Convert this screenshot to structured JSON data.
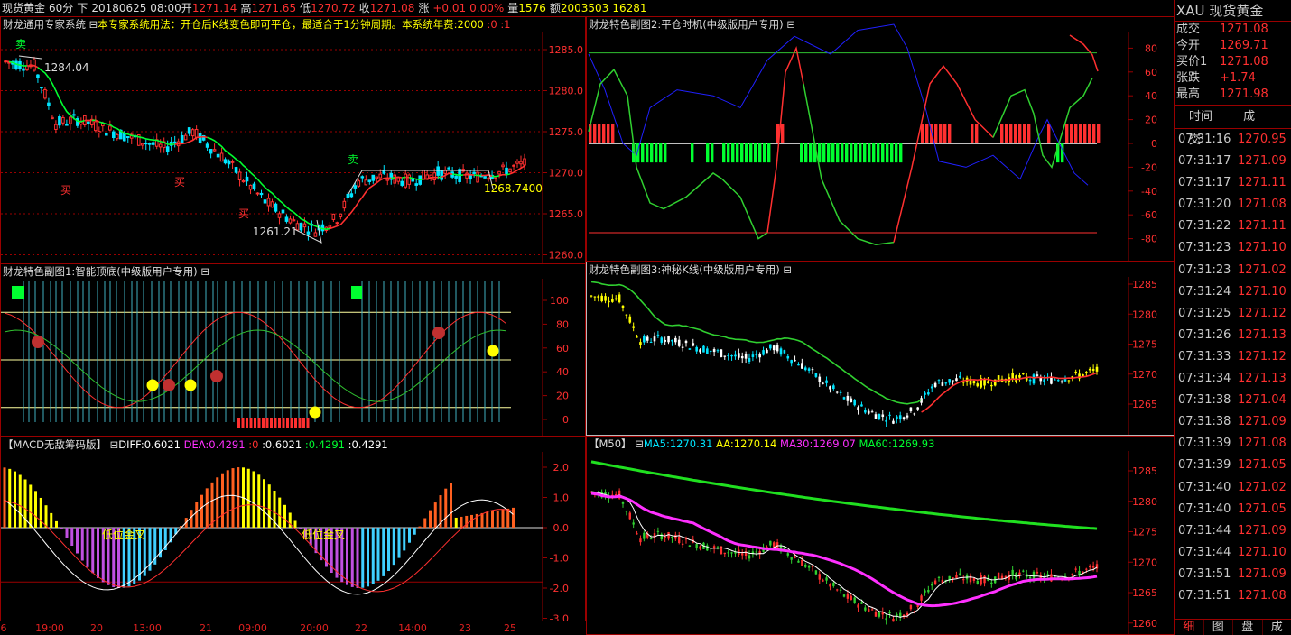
{
  "topbar": {
    "name": "现货黄金",
    "period": "60分",
    "direction": "下",
    "date": "20180625 08:00",
    "open_label": "开",
    "open": "1271.14",
    "high_label": "高",
    "high": "1271.65",
    "low_label": "低",
    "low": "1270.72",
    "close_label": "收",
    "close": "1271.08",
    "change_label": "涨",
    "change": "+0.01",
    "change_pct": "0.00%",
    "volume_label": "量",
    "volume": "1576",
    "amount_label": "额",
    "amount": "2003503",
    "hold": "16281"
  },
  "panels": {
    "main": {
      "title_system": "财龙通用专家系统",
      "title_icon": "⊟",
      "title_usage": "本专家系统用法：开仓后K线变色即可平仓，最适合于1分钟周期。本系统年费:2000",
      "title_v1": ":0",
      "title_v2": ":1",
      "yticks": [
        "1285.0",
        "1280.0",
        "1275.0",
        "1270.0",
        "1265.0",
        "1260.0"
      ],
      "label_high": "1284.04",
      "label_low": "1261.21",
      "label_last": "1268.7400",
      "buy_signal": "买",
      "sell_signal": "卖"
    },
    "sub1": {
      "title": "财龙特色副图1:智能顶底(中级版用户专用)",
      "title_icon": "⊟",
      "yticks": [
        "100",
        "80",
        "60",
        "40",
        "20",
        "0"
      ]
    },
    "sub2": {
      "title": "财龙特色副图2:平仓时机(中级版用户专用)",
      "title_icon": "⊟",
      "yticks": [
        "80",
        "60",
        "40",
        "20",
        "0",
        "-20",
        "-40",
        "-60",
        "-80"
      ]
    },
    "sub3": {
      "title": "财龙特色副图3:神秘K线(中级版用户专用)",
      "title_icon": "⊟",
      "yticks": [
        "1285",
        "1280",
        "1275",
        "1270",
        "1265"
      ]
    },
    "macd": {
      "title": "【MACD无敌筹码版】",
      "title_icon": "⊟",
      "diff": "DIFF:0.6021",
      "dea": "DEA:0.4291",
      "v0": ":0",
      "v1": ":0.6021",
      "v2": ":0.4291",
      "v3": ":0.4291",
      "yticks": [
        "2.0",
        "1.0",
        "0.0",
        "-1.0",
        "-2.0",
        "-3.0"
      ],
      "label_cross1": "低位金叉",
      "label_cross2": "低位金叉"
    },
    "ma": {
      "title": "【M50】",
      "title_icon": "⊟",
      "ma5": "MA5:1270.31",
      "aa": "AA:1270.14",
      "ma30": "MA30:1269.07",
      "ma60": "MA60:1269.93",
      "yticks": [
        "1285",
        "1280",
        "1275",
        "1270",
        "1265",
        "1260"
      ]
    }
  },
  "xaxis": {
    "labels": [
      "6",
      "19:00",
      "20",
      "13:00",
      "21",
      "09:00",
      "20:00",
      "22",
      "14:00",
      "23",
      "25"
    ]
  },
  "quote": {
    "symbol": "XAU",
    "name": "现货黄金",
    "rows": [
      {
        "label": "成交",
        "value": "1271.08"
      },
      {
        "label": "今开",
        "value": "1269.71"
      },
      {
        "label": "买价1",
        "value": "1271.08"
      },
      {
        "label": "张跌",
        "value": "+1.74"
      },
      {
        "label": "最高",
        "value": "1271.98"
      }
    ],
    "trade_header_time": "时间",
    "trade_header_price": "成交",
    "trades": [
      {
        "time": "07:31:16",
        "price": "1270.95"
      },
      {
        "time": "07:31:17",
        "price": "1271.09"
      },
      {
        "time": "07:31:17",
        "price": "1271.11"
      },
      {
        "time": "07:31:20",
        "price": "1271.08"
      },
      {
        "time": "07:31:22",
        "price": "1271.11"
      },
      {
        "time": "07:31:23",
        "price": "1271.10"
      },
      {
        "time": "07:31:23",
        "price": "1271.02"
      },
      {
        "time": "07:31:24",
        "price": "1271.10"
      },
      {
        "time": "07:31:25",
        "price": "1271.12"
      },
      {
        "time": "07:31:26",
        "price": "1271.13"
      },
      {
        "time": "07:31:33",
        "price": "1271.12"
      },
      {
        "time": "07:31:34",
        "price": "1271.13"
      },
      {
        "time": "07:31:38",
        "price": "1271.04"
      },
      {
        "time": "07:31:38",
        "price": "1271.09"
      },
      {
        "time": "07:31:39",
        "price": "1271.08"
      },
      {
        "time": "07:31:39",
        "price": "1271.05"
      },
      {
        "time": "07:31:40",
        "price": "1271.02"
      },
      {
        "time": "07:31:40",
        "price": "1271.05"
      },
      {
        "time": "07:31:44",
        "price": "1271.09"
      },
      {
        "time": "07:31:44",
        "price": "1271.10"
      },
      {
        "time": "07:31:51",
        "price": "1271.09"
      },
      {
        "time": "07:31:51",
        "price": "1271.08"
      }
    ],
    "tabs": [
      "细",
      "图",
      "盘",
      "成"
    ]
  },
  "colors": {
    "up": "#ff3030",
    "down": "#00e5ff",
    "green": "#00ff30",
    "yellow": "#ffff00",
    "magenta": "#ff30ff",
    "blue": "#2020ff",
    "grid": "#9a0000"
  }
}
